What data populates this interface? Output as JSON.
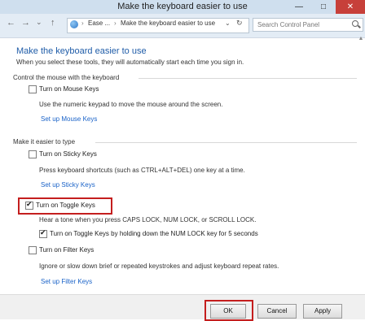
{
  "window": {
    "title": "Make the keyboard easier to use",
    "minimize": "—",
    "maximize": "□",
    "close": "✕"
  },
  "nav": {
    "back": "←",
    "forward": "→",
    "recent": "⌄",
    "up": "↑",
    "address_segments": [
      "Ease ...",
      "Make the keyboard easier to use"
    ],
    "address_sep": "›",
    "dropdown": "⌄",
    "refresh": "↻",
    "search_placeholder": "Search Control Panel"
  },
  "main": {
    "heading": "Make the keyboard easier to use",
    "intro": "When you select these tools, they will automatically start each time you sign in.",
    "section_mouse": {
      "label": "Control the mouse with the keyboard",
      "option": {
        "label": "Turn on Mouse Keys",
        "checked": false
      },
      "description": "Use the numeric keypad to move the mouse around the screen.",
      "link": "Set up Mouse Keys"
    },
    "section_typing": {
      "label": "Make it easier to type",
      "sticky": {
        "label": "Turn on Sticky Keys",
        "checked": false,
        "description": "Press keyboard shortcuts (such as CTRL+ALT+DEL) one key at a time.",
        "link": "Set up Sticky Keys"
      },
      "toggle": {
        "label": "Turn on Toggle Keys",
        "checked": true,
        "description": "Hear a tone when you press CAPS LOCK, NUM LOCK, or SCROLL LOCK.",
        "sub_option": {
          "label": "Turn on Toggle Keys by holding down the NUM LOCK key for 5 seconds",
          "checked": true
        }
      },
      "filter": {
        "label": "Turn on Filter Keys",
        "checked": false,
        "description": "Ignore or slow down brief or repeated keystrokes and adjust keyboard repeat rates.",
        "link": "Set up Filter Keys"
      }
    }
  },
  "footer": {
    "ok": "OK",
    "cancel": "Cancel",
    "apply": "Apply"
  },
  "colors": {
    "heading_blue": "#1f5ca8",
    "link_blue": "#1a63c8",
    "highlight_red": "#c41e1e"
  }
}
